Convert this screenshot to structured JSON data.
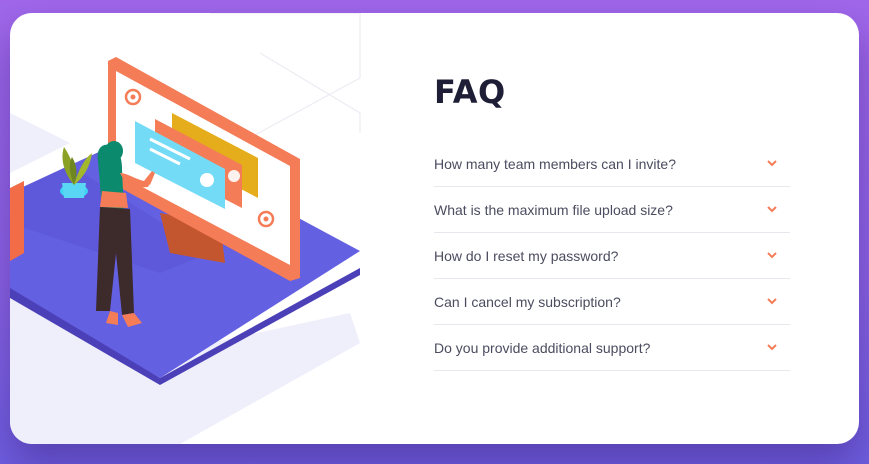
{
  "faq": {
    "title": "FAQ",
    "items": [
      {
        "question": "How many team members can I invite?"
      },
      {
        "question": "What is the maximum file upload size?"
      },
      {
        "question": "How do I reset my password?"
      },
      {
        "question": "Can I cancel my subscription?"
      },
      {
        "question": "Do you provide additional support?"
      }
    ],
    "icon": "chevron-down-icon"
  },
  "colors": {
    "accent": "#f47c57",
    "title": "#1e1f36",
    "text": "#4b4c5f",
    "divider": "#e7e7ee",
    "background_top": "#a067ea",
    "background_bottom": "#6e5fe0",
    "platform": "#5f5de0"
  }
}
